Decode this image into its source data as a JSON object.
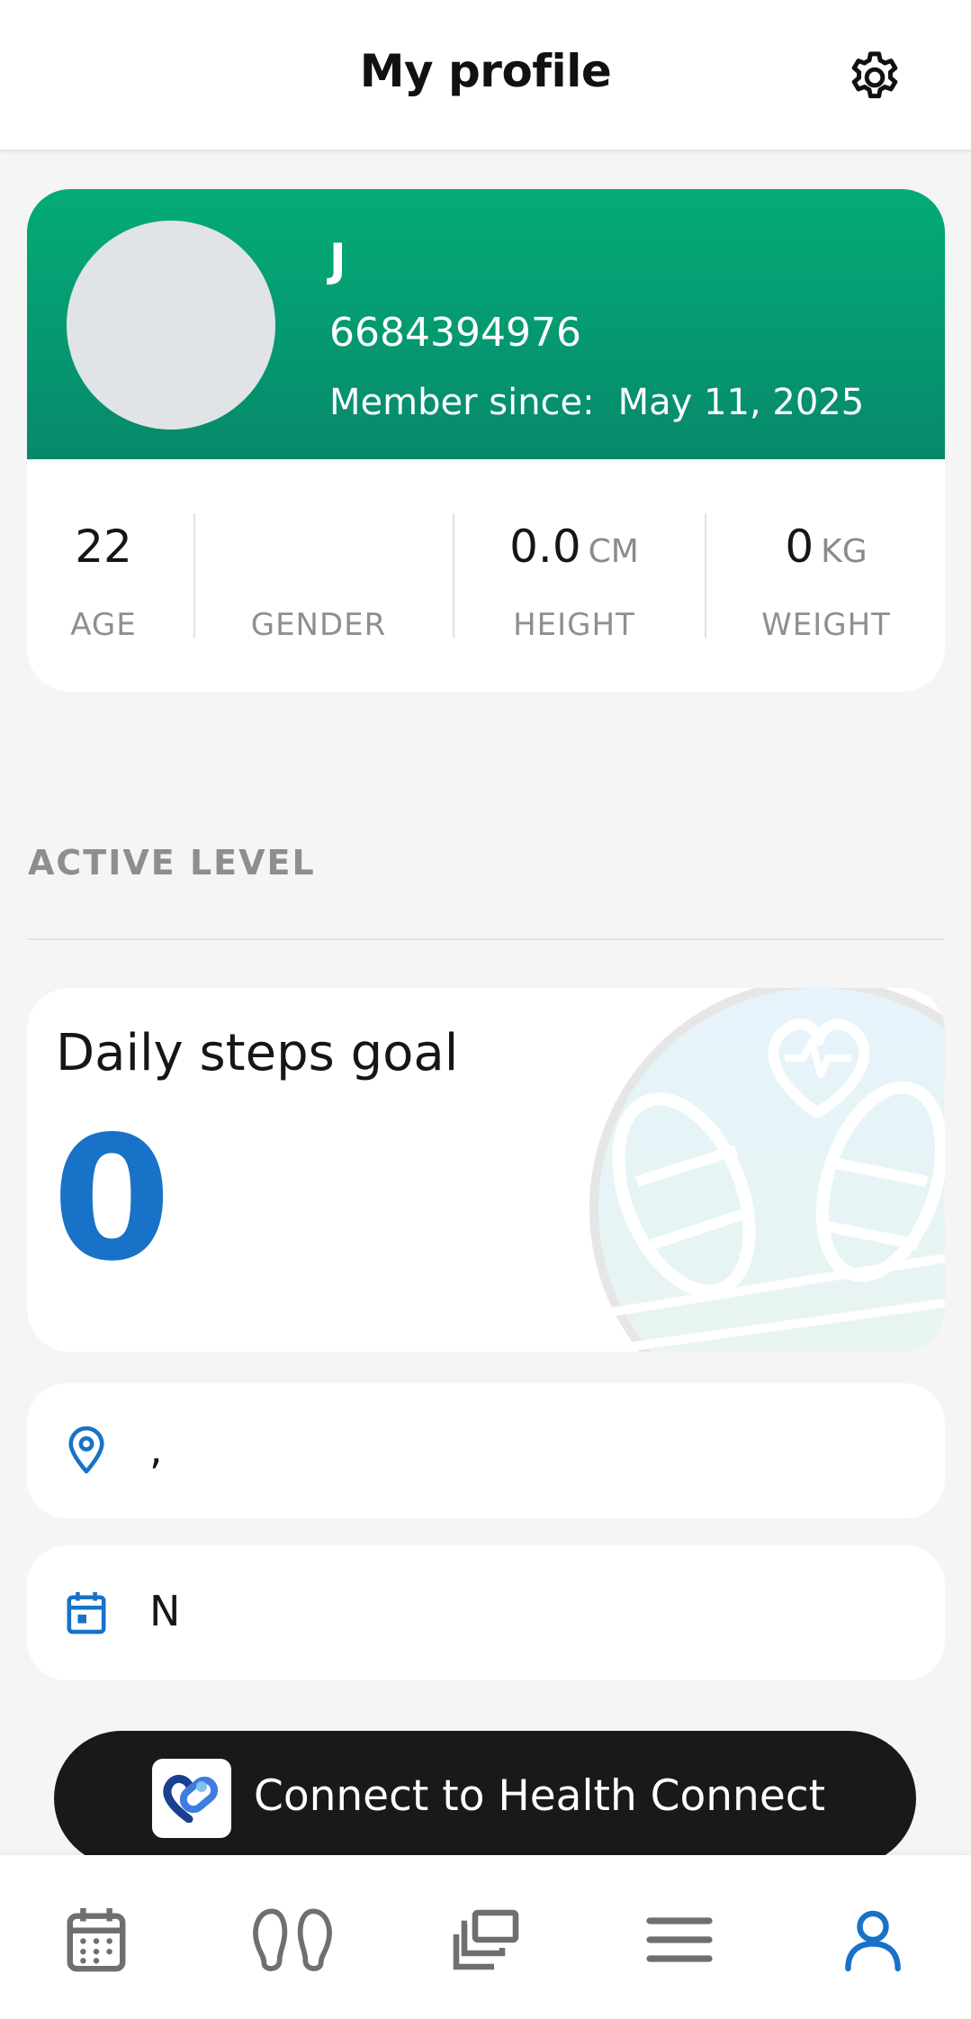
{
  "header": {
    "title": "My profile",
    "settings_icon": "gear-icon"
  },
  "profile": {
    "initial": "J",
    "phone": "6684394976",
    "member_since_label": "Member since:",
    "member_since_date": "May 11, 2025",
    "gradient_colors": [
      "#04ab77",
      "#07896b"
    ]
  },
  "stats": {
    "age": {
      "value": "22",
      "label": "AGE"
    },
    "gender": {
      "value": "",
      "label": "GENDER"
    },
    "height": {
      "value": "0.0",
      "unit": "CM",
      "label": "HEIGHT"
    },
    "weight": {
      "value": "0",
      "unit": "KG",
      "label": "WEIGHT"
    }
  },
  "active_level": {
    "section_title": "ACTIVE LEVEL",
    "steps_title": "Daily steps goal",
    "steps_value": "0",
    "accent_color": "#1872c7"
  },
  "info": {
    "location_icon": "location-pin-icon",
    "location_text": ",",
    "calendar_icon": "calendar-icon",
    "calendar_text": "N"
  },
  "connect": {
    "label": "Connect to Health Connect",
    "icon": "health-connect-logo"
  },
  "bottom_nav": {
    "items": [
      {
        "icon": "calendar-icon",
        "active": false
      },
      {
        "icon": "footprints-icon",
        "active": false
      },
      {
        "icon": "gallery-icon",
        "active": false
      },
      {
        "icon": "menu-icon",
        "active": false
      },
      {
        "icon": "profile-icon",
        "active": true
      }
    ]
  }
}
